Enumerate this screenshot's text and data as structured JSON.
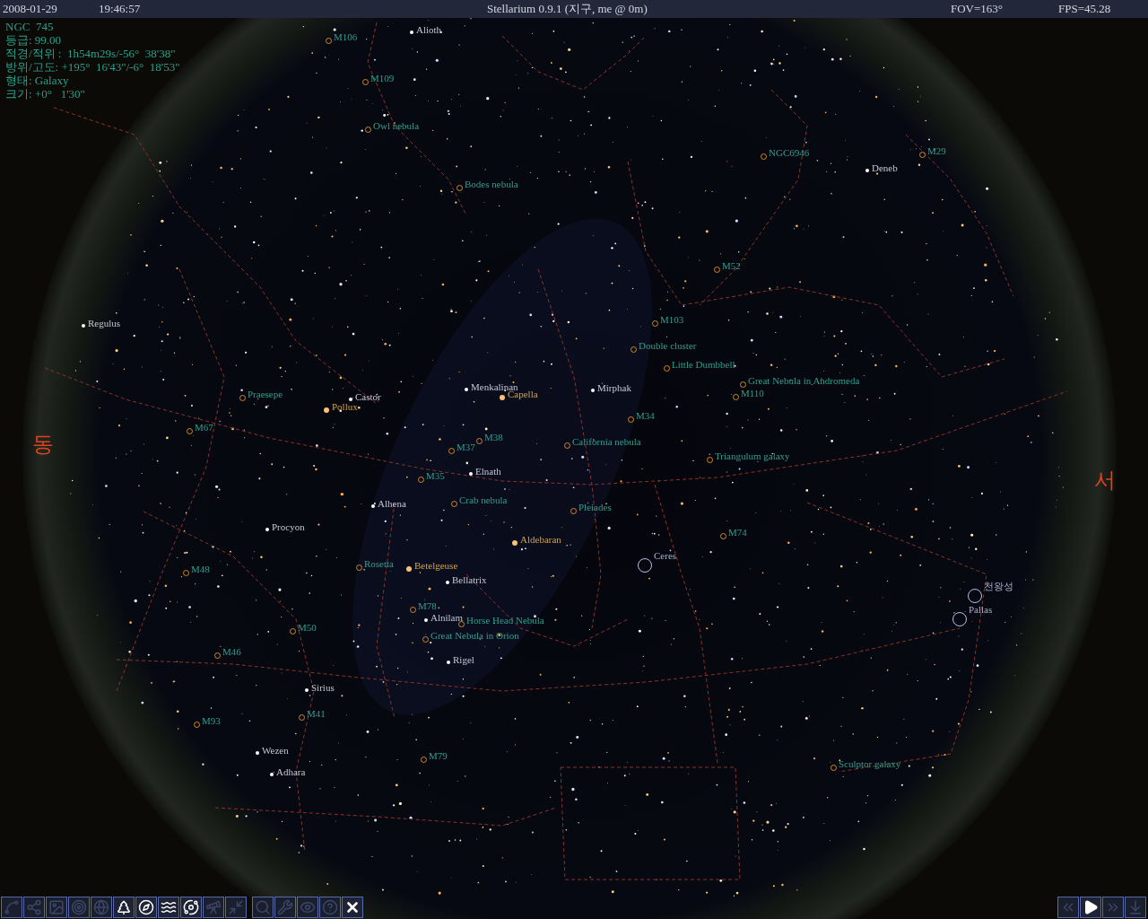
{
  "top_bar": {
    "date": "2008-01-29",
    "time": "19:46:57",
    "title": "Stellarium 0.9.1 (지구, me @ 0m)",
    "fov": "FOV=163°",
    "fps": "FPS=45.28"
  },
  "info_panel": {
    "lines": [
      "NGC  745",
      "등급: 99.00",
      "적경/적위 :  1h54m29s/-56°  38'38\"",
      "방위/고도: +195°  16'43\"/-6°  18'53\"",
      "형태: Galaxy",
      "크기: +0°   1'30\""
    ]
  },
  "sky_labels": [
    {
      "text": "M106",
      "kind": "nebula"
    },
    {
      "text": "Alioth",
      "kind": "star"
    },
    {
      "text": "M109",
      "kind": "nebula"
    },
    {
      "text": "Owl nebula",
      "kind": "nebula"
    },
    {
      "text": "Bodes nebula",
      "kind": "nebula"
    },
    {
      "text": "NGC6946",
      "kind": "nebula"
    },
    {
      "text": "M29",
      "kind": "nebula"
    },
    {
      "text": "Deneb",
      "kind": "star"
    },
    {
      "text": "M52",
      "kind": "nebula"
    },
    {
      "text": "Regulus",
      "kind": "star"
    },
    {
      "text": "M103",
      "kind": "nebula"
    },
    {
      "text": "Double cluster",
      "kind": "nebula"
    },
    {
      "text": "Little Dumbbell",
      "kind": "nebula"
    },
    {
      "text": "Praesepe",
      "kind": "nebula"
    },
    {
      "text": "Castor",
      "kind": "star"
    },
    {
      "text": "Menkalinan",
      "kind": "star"
    },
    {
      "text": "Capella",
      "kind": "bright_star"
    },
    {
      "text": "Mirphak",
      "kind": "star"
    },
    {
      "text": "Great Nebula in Andromeda",
      "kind": "nebula"
    },
    {
      "text": "M110",
      "kind": "nebula"
    },
    {
      "text": "Pollux",
      "kind": "bright_star"
    },
    {
      "text": "M67",
      "kind": "nebula"
    },
    {
      "text": "M34",
      "kind": "nebula"
    },
    {
      "text": "M38",
      "kind": "nebula"
    },
    {
      "text": "M37",
      "kind": "nebula"
    },
    {
      "text": "California nebula",
      "kind": "nebula"
    },
    {
      "text": "Triangulum galaxy",
      "kind": "nebula"
    },
    {
      "text": "Elnath",
      "kind": "star"
    },
    {
      "text": "M35",
      "kind": "nebula"
    },
    {
      "text": "Crab nebula",
      "kind": "nebula"
    },
    {
      "text": "Alhena",
      "kind": "star"
    },
    {
      "text": "Pleiades",
      "kind": "nebula"
    },
    {
      "text": "Procyon",
      "kind": "star"
    },
    {
      "text": "M74",
      "kind": "nebula"
    },
    {
      "text": "Aldebaran",
      "kind": "bright_star"
    },
    {
      "text": "Ceres",
      "kind": "planet"
    },
    {
      "text": "M48",
      "kind": "nebula"
    },
    {
      "text": "Rosetta",
      "kind": "nebula"
    },
    {
      "text": "Betelgeuse",
      "kind": "bright_star"
    },
    {
      "text": "Bellatrix",
      "kind": "star"
    },
    {
      "text": "천왕성",
      "kind": "planet"
    },
    {
      "text": "Pallas",
      "kind": "planet"
    },
    {
      "text": "M78",
      "kind": "nebula"
    },
    {
      "text": "Alnilam",
      "kind": "star"
    },
    {
      "text": "Horse Head Nebula",
      "kind": "nebula"
    },
    {
      "text": "M50",
      "kind": "nebula"
    },
    {
      "text": "Great Nebula in Orion",
      "kind": "nebula"
    },
    {
      "text": "M46",
      "kind": "nebula"
    },
    {
      "text": "Rigel",
      "kind": "star"
    },
    {
      "text": "Sirius",
      "kind": "star"
    },
    {
      "text": "M41",
      "kind": "nebula"
    },
    {
      "text": "M93",
      "kind": "nebula"
    },
    {
      "text": "Wezen",
      "kind": "star"
    },
    {
      "text": "M79",
      "kind": "nebula"
    },
    {
      "text": "Sculptor galaxy",
      "kind": "nebula"
    },
    {
      "text": "Adhara",
      "kind": "star"
    },
    {
      "text": "동",
      "kind": "cardinal"
    },
    {
      "text": "서",
      "kind": "cardinal"
    }
  ],
  "toolbar": {
    "view_buttons": [
      {
        "kind": "constellation_lines",
        "on": false
      },
      {
        "kind": "constellation_names",
        "on": false
      },
      {
        "kind": "constellation_art",
        "on": false
      },
      {
        "kind": "equatorial_grid",
        "on": false
      },
      {
        "kind": "azimuthal_grid",
        "on": false
      },
      {
        "kind": "ground",
        "on": true
      },
      {
        "kind": "cardinal_points",
        "on": true
      },
      {
        "kind": "atmosphere",
        "on": true
      },
      {
        "kind": "nebulae",
        "on": true
      },
      {
        "kind": "mount",
        "on": false
      },
      {
        "kind": "center",
        "on": false
      }
    ],
    "app_buttons": [
      {
        "kind": "search",
        "on": false
      },
      {
        "kind": "config",
        "on": false
      },
      {
        "kind": "night",
        "on": false
      },
      {
        "kind": "help",
        "on": false
      },
      {
        "kind": "quit",
        "on": true
      }
    ],
    "time_buttons": [
      {
        "kind": "rewind",
        "on": false
      },
      {
        "kind": "play",
        "on": true
      },
      {
        "kind": "forward",
        "on": false
      },
      {
        "kind": "now",
        "on": false
      }
    ]
  }
}
